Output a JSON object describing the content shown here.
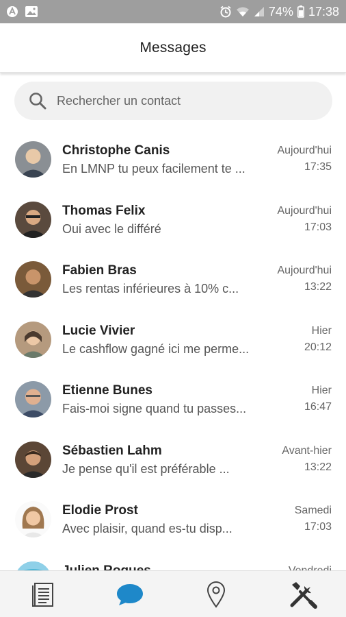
{
  "status_bar": {
    "battery": "74%",
    "time": "17:38"
  },
  "header": {
    "title": "Messages"
  },
  "search": {
    "placeholder": "Rechercher un contact"
  },
  "conversations": [
    {
      "name": "Christophe Canis",
      "preview": "En LMNP tu peux facilement te ...",
      "day": "Aujourd'hui",
      "time": "17:35",
      "avatar_color": "#8a8f94"
    },
    {
      "name": "Thomas Felix",
      "preview": "Oui avec le différé",
      "day": "Aujourd'hui",
      "time": "17:03",
      "avatar_color": "#5a4a3e"
    },
    {
      "name": "Fabien Bras",
      "preview": "Les rentas inférieures à 10% c...",
      "day": "Aujourd'hui",
      "time": "13:22",
      "avatar_color": "#7a5a3a"
    },
    {
      "name": "Lucie Vivier",
      "preview": "Le cashflow gagné ici me perme...",
      "day": "Hier",
      "time": "20:12",
      "avatar_color": "#b59a7e"
    },
    {
      "name": "Etienne Bunes",
      "preview": "Fais-moi signe quand tu passes...",
      "day": "Hier",
      "time": "16:47",
      "avatar_color": "#8c9aa8"
    },
    {
      "name": "Sébastien Lahm",
      "preview": "Je pense qu'il est préférable ...",
      "day": "Avant-hier",
      "time": "13:22",
      "avatar_color": "#5b4636"
    },
    {
      "name": "Elodie Prost",
      "preview": "Avec plaisir, quand es-tu disp...",
      "day": "Samedi",
      "time": "17:03",
      "avatar_color": "#a07850"
    },
    {
      "name": "Julien Roques",
      "preview": "",
      "day": "Vendredi",
      "time": "",
      "avatar_color": "#4fb6d6"
    }
  ],
  "colors": {
    "accent": "#1e88c9",
    "status_bar": "#9e9e9e",
    "search_bg": "#f1f1f1",
    "nav_bg": "#f4f4f4"
  },
  "bottom_nav": [
    {
      "icon": "document-list-icon",
      "active": false
    },
    {
      "icon": "chat-bubble-icon",
      "active": true
    },
    {
      "icon": "location-pin-icon",
      "active": false
    },
    {
      "icon": "tools-icon",
      "active": false
    }
  ]
}
